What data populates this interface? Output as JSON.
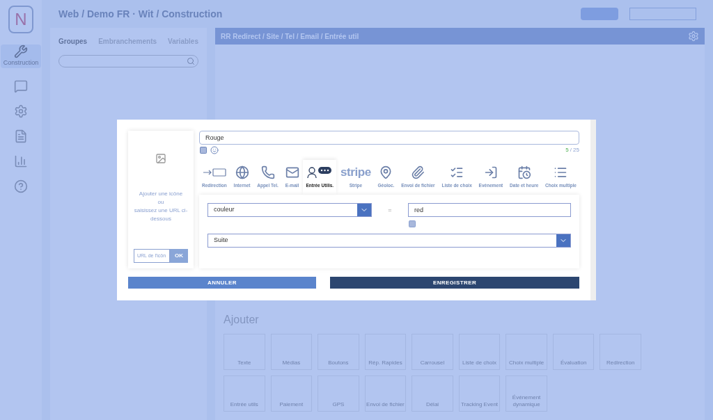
{
  "background": {
    "logo_text": "N",
    "breadcrumb": "Web / Demo FR · Wit / Construction",
    "sidebar": [
      {
        "label": "Construction",
        "selected": true,
        "kind": "wrench"
      },
      {
        "selected": false,
        "kind": "chat"
      },
      {
        "selected": false,
        "kind": "gear"
      },
      {
        "selected": false,
        "kind": "file"
      },
      {
        "selected": false,
        "kind": "chart"
      },
      {
        "selected": false,
        "kind": "help"
      }
    ],
    "left_tabs": [
      {
        "label": "Groupes",
        "selected": true
      },
      {
        "label": "Embranchements",
        "selected": false
      },
      {
        "label": "Variables",
        "selected": false
      }
    ],
    "panel_title": "RR Redirect / Site / Tel / Email / Entrée util",
    "add_title": "Ajouter",
    "tiles": [
      "Texte",
      "Médias",
      "Boutons",
      "Rép. Rapides",
      "Carrousel",
      "Liste de choix",
      "Choix multiple",
      "Évaluation",
      "Redirection",
      "Entrée utils",
      "Paiement",
      "GPS",
      "Envoi de fichier",
      "Délai",
      "Tracking Event",
      "Événement dynamique"
    ]
  },
  "modal": {
    "icon_hint_lines": [
      "Ajouter une icône",
      "ou",
      "saisissez une URL ci-dessous"
    ],
    "icon_url": {
      "placeholder": "URL de l'icôn"
    },
    "ok_button": "OK",
    "title_field": {
      "value": "Rouge"
    },
    "count": "5",
    "count_max": "/ 25",
    "tabs": [
      {
        "label": "Redirection",
        "kind": "redirect",
        "selected": false
      },
      {
        "label": "Internet",
        "kind": "globe",
        "selected": false
      },
      {
        "label": "Appel Tel.",
        "kind": "phone",
        "selected": false
      },
      {
        "label": "E-mail",
        "kind": "mail",
        "selected": false
      },
      {
        "label": "Entrée Utilis.",
        "kind": "user",
        "selected": true
      },
      {
        "label": "Stripe",
        "kind": "stripe",
        "logo_text": "stripe",
        "selected": false
      },
      {
        "label": "Géoloc.",
        "kind": "pin",
        "selected": false
      },
      {
        "label": "Envoi de fichier",
        "kind": "clip",
        "selected": false
      },
      {
        "label": "Liste de choix",
        "kind": "list",
        "selected": false
      },
      {
        "label": "Evènement",
        "kind": "event",
        "selected": false
      },
      {
        "label": "Date et heure",
        "kind": "calendar",
        "selected": false
      },
      {
        "label": "Choix multiple",
        "kind": "multi",
        "selected": false
      }
    ],
    "variable_select": {
      "value": "couleur"
    },
    "operator": "=",
    "value_field": {
      "value": "red"
    },
    "next_select": {
      "value": "Suite"
    },
    "cancel_button": "ANNULER",
    "save_button": "ENREGISTRER"
  }
}
